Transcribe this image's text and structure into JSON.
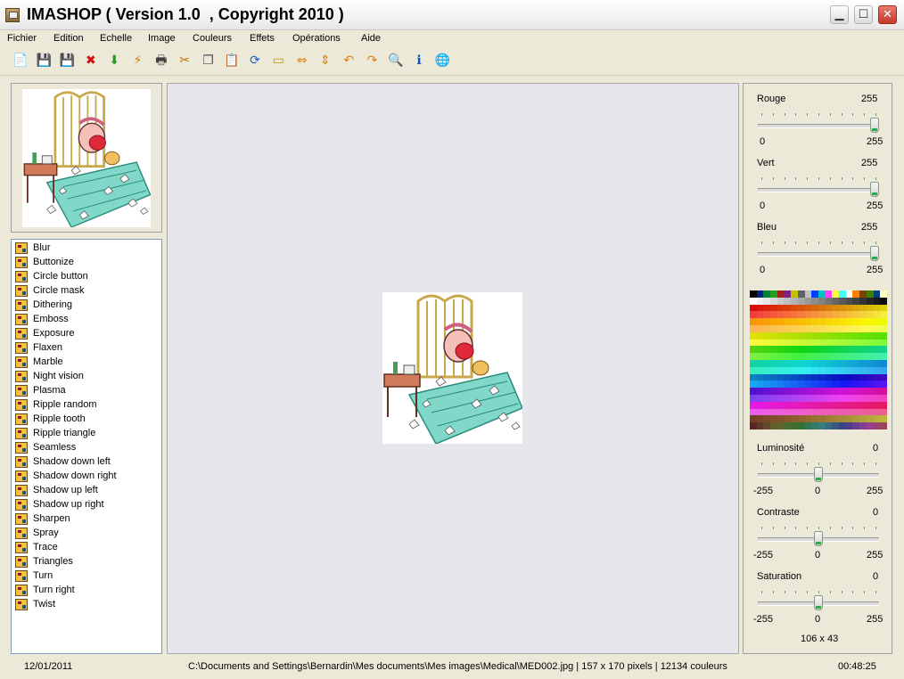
{
  "window": {
    "title": "IMASHOP ( Version 1.0  , Copyright 2010 )"
  },
  "menu": [
    "Fichier",
    "Edition",
    "Echelle",
    "Image",
    "Couleurs",
    "Effets",
    "Opérations",
    "Aide"
  ],
  "toolbar": [
    {
      "icon": "new-icon",
      "glyph": "📄",
      "color": "#d04020"
    },
    {
      "icon": "save-icon",
      "glyph": "💾",
      "color": "#2040a0"
    },
    {
      "icon": "save-as-icon",
      "glyph": "💾",
      "color": "#a06020"
    },
    {
      "icon": "delete-icon",
      "glyph": "✖",
      "color": "#d01010"
    },
    {
      "icon": "download-icon",
      "glyph": "⬇",
      "color": "#20a020"
    },
    {
      "icon": "flash-icon",
      "glyph": "⚡",
      "color": "#d08000"
    },
    {
      "icon": "print-icon",
      "glyph": "🖶",
      "color": "#404040"
    },
    {
      "icon": "cut-icon",
      "glyph": "✂",
      "color": "#c07000"
    },
    {
      "icon": "copy-icon",
      "glyph": "❐",
      "color": "#505050"
    },
    {
      "icon": "paste-icon",
      "glyph": "📋",
      "color": "#806020"
    },
    {
      "icon": "refresh-icon",
      "glyph": "⟳",
      "color": "#2060c0"
    },
    {
      "icon": "crop-icon",
      "glyph": "▭",
      "color": "#d09000"
    },
    {
      "icon": "flip-horizontal-icon",
      "glyph": "⇔",
      "color": "#e08010"
    },
    {
      "icon": "flip-vertical-icon",
      "glyph": "⇕",
      "color": "#e08010"
    },
    {
      "icon": "undo-icon",
      "glyph": "↶",
      "color": "#e08010"
    },
    {
      "icon": "redo-icon",
      "glyph": "↷",
      "color": "#e08010"
    },
    {
      "icon": "zoom-icon",
      "glyph": "🔍",
      "color": "#2060a0"
    },
    {
      "icon": "info-icon",
      "glyph": "ℹ",
      "color": "#1050c0"
    },
    {
      "icon": "globe-icon",
      "glyph": "🌐",
      "color": "#1080a0"
    }
  ],
  "effects": [
    "Blur",
    "Buttonize",
    "Circle button",
    "Circle mask",
    "Dithering",
    "Emboss",
    "Exposure",
    "Flaxen",
    "Marble",
    "Night vision",
    "Plasma",
    "Ripple random",
    "Ripple tooth",
    "Ripple triangle",
    "Seamless",
    "Shadow down left",
    "Shadow down right",
    "Shadow up left",
    "Shadow up right",
    "Sharpen",
    "Spray",
    "Trace",
    "Triangles",
    "Turn",
    "Turn right",
    "Twist"
  ],
  "rgb_sliders": [
    {
      "label": "Rouge",
      "value": "255",
      "min": "0",
      "max": "255",
      "level": 1.0
    },
    {
      "label": "Vert",
      "value": "255",
      "min": "0",
      "max": "255",
      "level": 1.0
    },
    {
      "label": "Bleu",
      "value": "255",
      "min": "0",
      "max": "255",
      "level": 1.0
    }
  ],
  "adjust_sliders": [
    {
      "label": "Luminosité",
      "value": "0",
      "min": "-255",
      "mid": "0",
      "max": "255",
      "level": 0.5
    },
    {
      "label": "Contraste",
      "value": "0",
      "min": "-255",
      "mid": "0",
      "max": "255",
      "level": 0.5
    },
    {
      "label": "Saturation",
      "value": "0",
      "min": "-255",
      "mid": "0",
      "max": "255",
      "level": 0.5
    }
  ],
  "cursor_position": "106 x 43",
  "status": {
    "date": "12/01/2011",
    "info": "C:\\Documents and Settings\\Bernardin\\Mes documents\\Mes images\\Medical\\MED002.jpg | 157 x 170 pixels | 12134 couleurs",
    "time": "00:48:25"
  }
}
